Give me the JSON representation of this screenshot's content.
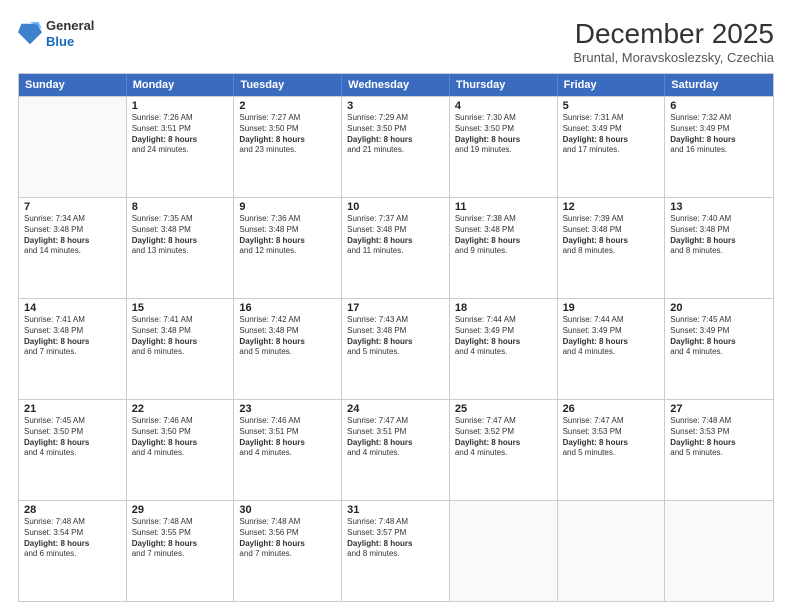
{
  "logo": {
    "general": "General",
    "blue": "Blue"
  },
  "header": {
    "title": "December 2025",
    "location": "Bruntal, Moravskoslezsky, Czechia"
  },
  "days_of_week": [
    "Sunday",
    "Monday",
    "Tuesday",
    "Wednesday",
    "Thursday",
    "Friday",
    "Saturday"
  ],
  "weeks": [
    [
      {
        "day": "",
        "sunrise": "",
        "sunset": "",
        "daylight": ""
      },
      {
        "day": "1",
        "sunrise": "Sunrise: 7:26 AM",
        "sunset": "Sunset: 3:51 PM",
        "daylight": "Daylight: 8 hours and 24 minutes."
      },
      {
        "day": "2",
        "sunrise": "Sunrise: 7:27 AM",
        "sunset": "Sunset: 3:50 PM",
        "daylight": "Daylight: 8 hours and 23 minutes."
      },
      {
        "day": "3",
        "sunrise": "Sunrise: 7:29 AM",
        "sunset": "Sunset: 3:50 PM",
        "daylight": "Daylight: 8 hours and 21 minutes."
      },
      {
        "day": "4",
        "sunrise": "Sunrise: 7:30 AM",
        "sunset": "Sunset: 3:50 PM",
        "daylight": "Daylight: 8 hours and 19 minutes."
      },
      {
        "day": "5",
        "sunrise": "Sunrise: 7:31 AM",
        "sunset": "Sunset: 3:49 PM",
        "daylight": "Daylight: 8 hours and 17 minutes."
      },
      {
        "day": "6",
        "sunrise": "Sunrise: 7:32 AM",
        "sunset": "Sunset: 3:49 PM",
        "daylight": "Daylight: 8 hours and 16 minutes."
      }
    ],
    [
      {
        "day": "7",
        "sunrise": "Sunrise: 7:34 AM",
        "sunset": "Sunset: 3:48 PM",
        "daylight": "Daylight: 8 hours and 14 minutes."
      },
      {
        "day": "8",
        "sunrise": "Sunrise: 7:35 AM",
        "sunset": "Sunset: 3:48 PM",
        "daylight": "Daylight: 8 hours and 13 minutes."
      },
      {
        "day": "9",
        "sunrise": "Sunrise: 7:36 AM",
        "sunset": "Sunset: 3:48 PM",
        "daylight": "Daylight: 8 hours and 12 minutes."
      },
      {
        "day": "10",
        "sunrise": "Sunrise: 7:37 AM",
        "sunset": "Sunset: 3:48 PM",
        "daylight": "Daylight: 8 hours and 11 minutes."
      },
      {
        "day": "11",
        "sunrise": "Sunrise: 7:38 AM",
        "sunset": "Sunset: 3:48 PM",
        "daylight": "Daylight: 8 hours and 9 minutes."
      },
      {
        "day": "12",
        "sunrise": "Sunrise: 7:39 AM",
        "sunset": "Sunset: 3:48 PM",
        "daylight": "Daylight: 8 hours and 8 minutes."
      },
      {
        "day": "13",
        "sunrise": "Sunrise: 7:40 AM",
        "sunset": "Sunset: 3:48 PM",
        "daylight": "Daylight: 8 hours and 8 minutes."
      }
    ],
    [
      {
        "day": "14",
        "sunrise": "Sunrise: 7:41 AM",
        "sunset": "Sunset: 3:48 PM",
        "daylight": "Daylight: 8 hours and 7 minutes."
      },
      {
        "day": "15",
        "sunrise": "Sunrise: 7:41 AM",
        "sunset": "Sunset: 3:48 PM",
        "daylight": "Daylight: 8 hours and 6 minutes."
      },
      {
        "day": "16",
        "sunrise": "Sunrise: 7:42 AM",
        "sunset": "Sunset: 3:48 PM",
        "daylight": "Daylight: 8 hours and 5 minutes."
      },
      {
        "day": "17",
        "sunrise": "Sunrise: 7:43 AM",
        "sunset": "Sunset: 3:48 PM",
        "daylight": "Daylight: 8 hours and 5 minutes."
      },
      {
        "day": "18",
        "sunrise": "Sunrise: 7:44 AM",
        "sunset": "Sunset: 3:49 PM",
        "daylight": "Daylight: 8 hours and 4 minutes."
      },
      {
        "day": "19",
        "sunrise": "Sunrise: 7:44 AM",
        "sunset": "Sunset: 3:49 PM",
        "daylight": "Daylight: 8 hours and 4 minutes."
      },
      {
        "day": "20",
        "sunrise": "Sunrise: 7:45 AM",
        "sunset": "Sunset: 3:49 PM",
        "daylight": "Daylight: 8 hours and 4 minutes."
      }
    ],
    [
      {
        "day": "21",
        "sunrise": "Sunrise: 7:45 AM",
        "sunset": "Sunset: 3:50 PM",
        "daylight": "Daylight: 8 hours and 4 minutes."
      },
      {
        "day": "22",
        "sunrise": "Sunrise: 7:46 AM",
        "sunset": "Sunset: 3:50 PM",
        "daylight": "Daylight: 8 hours and 4 minutes."
      },
      {
        "day": "23",
        "sunrise": "Sunrise: 7:46 AM",
        "sunset": "Sunset: 3:51 PM",
        "daylight": "Daylight: 8 hours and 4 minutes."
      },
      {
        "day": "24",
        "sunrise": "Sunrise: 7:47 AM",
        "sunset": "Sunset: 3:51 PM",
        "daylight": "Daylight: 8 hours and 4 minutes."
      },
      {
        "day": "25",
        "sunrise": "Sunrise: 7:47 AM",
        "sunset": "Sunset: 3:52 PM",
        "daylight": "Daylight: 8 hours and 4 minutes."
      },
      {
        "day": "26",
        "sunrise": "Sunrise: 7:47 AM",
        "sunset": "Sunset: 3:53 PM",
        "daylight": "Daylight: 8 hours and 5 minutes."
      },
      {
        "day": "27",
        "sunrise": "Sunrise: 7:48 AM",
        "sunset": "Sunset: 3:53 PM",
        "daylight": "Daylight: 8 hours and 5 minutes."
      }
    ],
    [
      {
        "day": "28",
        "sunrise": "Sunrise: 7:48 AM",
        "sunset": "Sunset: 3:54 PM",
        "daylight": "Daylight: 8 hours and 6 minutes."
      },
      {
        "day": "29",
        "sunrise": "Sunrise: 7:48 AM",
        "sunset": "Sunset: 3:55 PM",
        "daylight": "Daylight: 8 hours and 7 minutes."
      },
      {
        "day": "30",
        "sunrise": "Sunrise: 7:48 AM",
        "sunset": "Sunset: 3:56 PM",
        "daylight": "Daylight: 8 hours and 7 minutes."
      },
      {
        "day": "31",
        "sunrise": "Sunrise: 7:48 AM",
        "sunset": "Sunset: 3:57 PM",
        "daylight": "Daylight: 8 hours and 8 minutes."
      },
      {
        "day": "",
        "sunrise": "",
        "sunset": "",
        "daylight": ""
      },
      {
        "day": "",
        "sunrise": "",
        "sunset": "",
        "daylight": ""
      },
      {
        "day": "",
        "sunrise": "",
        "sunset": "",
        "daylight": ""
      }
    ]
  ]
}
